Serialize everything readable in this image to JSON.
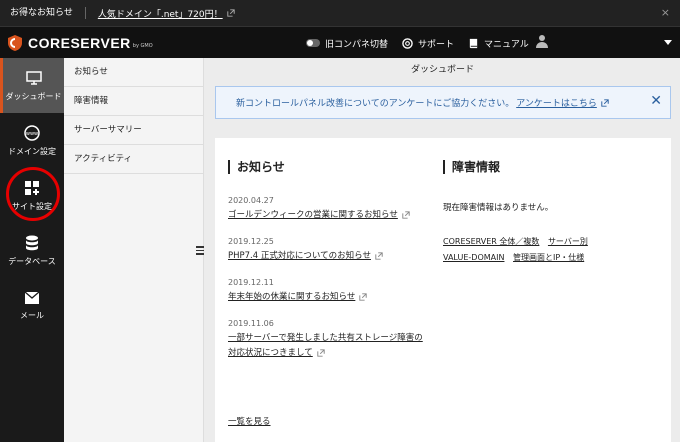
{
  "announcement": {
    "label": "お得なお知らせ",
    "link": "人気ドメイン「.net」720円！",
    "close": "×"
  },
  "header": {
    "logo": "CORESERVER",
    "logo_sub": "by GMO",
    "old_panel_toggle": "旧コンパネ切替",
    "support": "サポート",
    "manual": "マニュアル"
  },
  "sidenav": {
    "items": [
      {
        "label": "ダッシュボード",
        "icon": "monitor-icon"
      },
      {
        "label": "ドメイン設定",
        "icon": "www-globe-icon"
      },
      {
        "label": "サイト設定",
        "icon": "grid-plus-icon"
      },
      {
        "label": "データベース",
        "icon": "database-icon"
      },
      {
        "label": "メール",
        "icon": "mail-icon"
      }
    ]
  },
  "submenu": {
    "items": [
      "お知らせ",
      "障害情報",
      "サーバーサマリー",
      "アクティビティ"
    ]
  },
  "main": {
    "title": "ダッシュボード",
    "notice_text": "新コントロールパネル改善についてのアンケートにご協力ください。",
    "notice_link": "アンケートはこちら",
    "notice_close": "✕",
    "news": {
      "title": "お知らせ",
      "items": [
        {
          "date": "2020.04.27",
          "title": "ゴールデンウィークの営業に関するお知らせ"
        },
        {
          "date": "2019.12.25",
          "title": "PHP7.4 正式対応についてのお知らせ"
        },
        {
          "date": "2019.12.11",
          "title": "年末年始の休業に関するお知らせ"
        },
        {
          "date": "2019.11.06",
          "title": "一部サーバーで発生しました共有ストレージ障害の対応状況につきまして"
        }
      ],
      "more": "一覧を見る"
    },
    "trouble": {
      "title": "障害情報",
      "status": "現在障害情報はありません。",
      "links": [
        "CORESERVER 全体／複数",
        "サーバー別",
        "VALUE-DOMAIN",
        "管理画面とIP・仕様"
      ]
    }
  },
  "colors": {
    "accent": "#d9541e",
    "highlight": "#e60000",
    "notice_text": "#2a5f9e"
  }
}
